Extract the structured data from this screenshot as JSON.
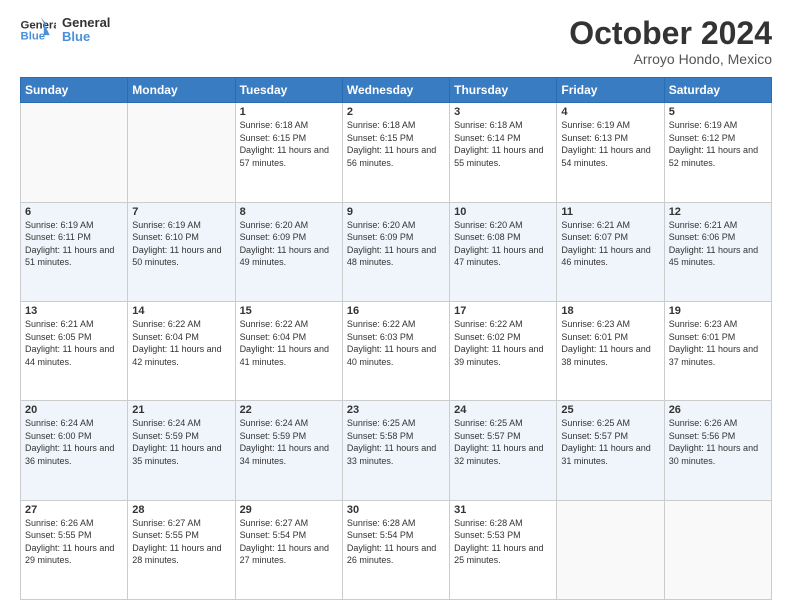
{
  "header": {
    "logo_line1": "General",
    "logo_line2": "Blue",
    "month_title": "October 2024",
    "subtitle": "Arroyo Hondo, Mexico"
  },
  "days_of_week": [
    "Sunday",
    "Monday",
    "Tuesday",
    "Wednesday",
    "Thursday",
    "Friday",
    "Saturday"
  ],
  "weeks": [
    [
      {
        "num": "",
        "info": ""
      },
      {
        "num": "",
        "info": ""
      },
      {
        "num": "1",
        "info": "Sunrise: 6:18 AM\nSunset: 6:15 PM\nDaylight: 11 hours and 57 minutes."
      },
      {
        "num": "2",
        "info": "Sunrise: 6:18 AM\nSunset: 6:15 PM\nDaylight: 11 hours and 56 minutes."
      },
      {
        "num": "3",
        "info": "Sunrise: 6:18 AM\nSunset: 6:14 PM\nDaylight: 11 hours and 55 minutes."
      },
      {
        "num": "4",
        "info": "Sunrise: 6:19 AM\nSunset: 6:13 PM\nDaylight: 11 hours and 54 minutes."
      },
      {
        "num": "5",
        "info": "Sunrise: 6:19 AM\nSunset: 6:12 PM\nDaylight: 11 hours and 52 minutes."
      }
    ],
    [
      {
        "num": "6",
        "info": "Sunrise: 6:19 AM\nSunset: 6:11 PM\nDaylight: 11 hours and 51 minutes."
      },
      {
        "num": "7",
        "info": "Sunrise: 6:19 AM\nSunset: 6:10 PM\nDaylight: 11 hours and 50 minutes."
      },
      {
        "num": "8",
        "info": "Sunrise: 6:20 AM\nSunset: 6:09 PM\nDaylight: 11 hours and 49 minutes."
      },
      {
        "num": "9",
        "info": "Sunrise: 6:20 AM\nSunset: 6:09 PM\nDaylight: 11 hours and 48 minutes."
      },
      {
        "num": "10",
        "info": "Sunrise: 6:20 AM\nSunset: 6:08 PM\nDaylight: 11 hours and 47 minutes."
      },
      {
        "num": "11",
        "info": "Sunrise: 6:21 AM\nSunset: 6:07 PM\nDaylight: 11 hours and 46 minutes."
      },
      {
        "num": "12",
        "info": "Sunrise: 6:21 AM\nSunset: 6:06 PM\nDaylight: 11 hours and 45 minutes."
      }
    ],
    [
      {
        "num": "13",
        "info": "Sunrise: 6:21 AM\nSunset: 6:05 PM\nDaylight: 11 hours and 44 minutes."
      },
      {
        "num": "14",
        "info": "Sunrise: 6:22 AM\nSunset: 6:04 PM\nDaylight: 11 hours and 42 minutes."
      },
      {
        "num": "15",
        "info": "Sunrise: 6:22 AM\nSunset: 6:04 PM\nDaylight: 11 hours and 41 minutes."
      },
      {
        "num": "16",
        "info": "Sunrise: 6:22 AM\nSunset: 6:03 PM\nDaylight: 11 hours and 40 minutes."
      },
      {
        "num": "17",
        "info": "Sunrise: 6:22 AM\nSunset: 6:02 PM\nDaylight: 11 hours and 39 minutes."
      },
      {
        "num": "18",
        "info": "Sunrise: 6:23 AM\nSunset: 6:01 PM\nDaylight: 11 hours and 38 minutes."
      },
      {
        "num": "19",
        "info": "Sunrise: 6:23 AM\nSunset: 6:01 PM\nDaylight: 11 hours and 37 minutes."
      }
    ],
    [
      {
        "num": "20",
        "info": "Sunrise: 6:24 AM\nSunset: 6:00 PM\nDaylight: 11 hours and 36 minutes."
      },
      {
        "num": "21",
        "info": "Sunrise: 6:24 AM\nSunset: 5:59 PM\nDaylight: 11 hours and 35 minutes."
      },
      {
        "num": "22",
        "info": "Sunrise: 6:24 AM\nSunset: 5:59 PM\nDaylight: 11 hours and 34 minutes."
      },
      {
        "num": "23",
        "info": "Sunrise: 6:25 AM\nSunset: 5:58 PM\nDaylight: 11 hours and 33 minutes."
      },
      {
        "num": "24",
        "info": "Sunrise: 6:25 AM\nSunset: 5:57 PM\nDaylight: 11 hours and 32 minutes."
      },
      {
        "num": "25",
        "info": "Sunrise: 6:25 AM\nSunset: 5:57 PM\nDaylight: 11 hours and 31 minutes."
      },
      {
        "num": "26",
        "info": "Sunrise: 6:26 AM\nSunset: 5:56 PM\nDaylight: 11 hours and 30 minutes."
      }
    ],
    [
      {
        "num": "27",
        "info": "Sunrise: 6:26 AM\nSunset: 5:55 PM\nDaylight: 11 hours and 29 minutes."
      },
      {
        "num": "28",
        "info": "Sunrise: 6:27 AM\nSunset: 5:55 PM\nDaylight: 11 hours and 28 minutes."
      },
      {
        "num": "29",
        "info": "Sunrise: 6:27 AM\nSunset: 5:54 PM\nDaylight: 11 hours and 27 minutes."
      },
      {
        "num": "30",
        "info": "Sunrise: 6:28 AM\nSunset: 5:54 PM\nDaylight: 11 hours and 26 minutes."
      },
      {
        "num": "31",
        "info": "Sunrise: 6:28 AM\nSunset: 5:53 PM\nDaylight: 11 hours and 25 minutes."
      },
      {
        "num": "",
        "info": ""
      },
      {
        "num": "",
        "info": ""
      }
    ]
  ]
}
